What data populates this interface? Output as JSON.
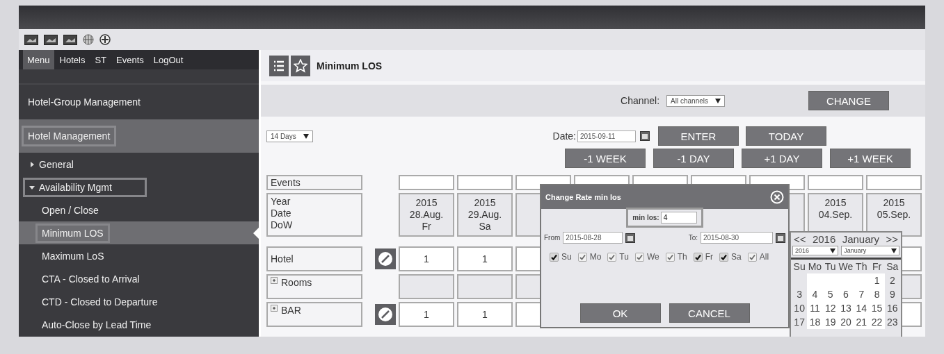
{
  "toolbar_icons": [
    {
      "kind": "image"
    },
    {
      "kind": "image"
    },
    {
      "kind": "image"
    },
    {
      "kind": "globe"
    },
    {
      "kind": "plus"
    }
  ],
  "nav": [
    {
      "label": "Menu",
      "selected": true
    },
    {
      "label": "Hotels",
      "selected": false
    },
    {
      "label": "ST",
      "selected": false
    },
    {
      "label": "Events",
      "selected": false
    },
    {
      "label": "LogOut",
      "selected": false
    }
  ],
  "sidebar": {
    "sections": [
      {
        "label": "Hotel-Group Management",
        "selected": false
      },
      {
        "label": "Hotel Management",
        "selected": true
      }
    ],
    "items": [
      {
        "label": "General",
        "expanded": false
      },
      {
        "label": "Availability Mgmt",
        "expanded": true,
        "children": [
          {
            "label": "Open / Close",
            "selected": false
          },
          {
            "label": "Minimum LOS",
            "selected": true
          },
          {
            "label": "Maximum LoS",
            "selected": false
          },
          {
            "label": "CTA - Closed to Arrival",
            "selected": false
          },
          {
            "label": "CTD - Closed to Departure",
            "selected": false
          },
          {
            "label": "Auto-Close by Lead Time",
            "selected": false
          }
        ]
      }
    ]
  },
  "page_title": "Minimum LOS",
  "channel": {
    "label": "Channel:",
    "value": "All channels",
    "button": "CHANGE"
  },
  "range_select": "14 Days",
  "date": {
    "label": "Date:",
    "value": "2015-09-11"
  },
  "buttons_row1": [
    "ENTER",
    "TODAY"
  ],
  "buttons_row2": [
    "-1 WEEK",
    "-1 DAY",
    "+1 DAY",
    "+1 WEEK"
  ],
  "grid": {
    "events_label": "Events",
    "header_labels": [
      "Year",
      "Date",
      "DoW"
    ],
    "columns": [
      {
        "year": "2015",
        "date": "28.Aug.",
        "dow": "Fr"
      },
      {
        "year": "2015",
        "date": "29.Aug.",
        "dow": "Sa"
      },
      {},
      {},
      {},
      {},
      {},
      {
        "year": "2015",
        "date": "04.Sep."
      },
      {
        "year": "2015",
        "date": "05.Sep."
      }
    ],
    "rows": [
      {
        "label": "Hotel",
        "kind": "value",
        "editable": true,
        "values": [
          "1",
          "1"
        ]
      },
      {
        "label": "Rooms",
        "kind": "group",
        "editable": false,
        "values": []
      },
      {
        "label": "BAR",
        "kind": "group-value",
        "editable": true,
        "values": [
          "1",
          "1"
        ]
      }
    ]
  },
  "dialog": {
    "title": "Change Rate min los",
    "min_los_label": "min los:",
    "min_los_value": "4",
    "from_label": "From",
    "from_value": "2015-08-28",
    "to_label": "To:",
    "to_value": "2015-08-30",
    "days": [
      {
        "label": "Su",
        "checked": true,
        "disabled": false
      },
      {
        "label": "Mo",
        "checked": true,
        "disabled": true
      },
      {
        "label": "Tu",
        "checked": true,
        "disabled": true
      },
      {
        "label": "We",
        "checked": true,
        "disabled": true
      },
      {
        "label": "Th",
        "checked": true,
        "disabled": true
      },
      {
        "label": "Fr",
        "checked": true,
        "disabled": false
      },
      {
        "label": "Sa",
        "checked": true,
        "disabled": false
      },
      {
        "label": "All",
        "checked": true,
        "disabled": true
      }
    ],
    "ok": "OK",
    "cancel": "CANCEL"
  },
  "calendar": {
    "prev": "<<",
    "year": "2016",
    "month": "January",
    "next": ">>",
    "year_select": "2016",
    "month_select": "January",
    "weekdays": [
      "Su",
      "Mo",
      "Tu",
      "We",
      "Th",
      "Fr",
      "Sa"
    ],
    "weeks": [
      [
        "1",
        "2"
      ],
      [
        "3",
        "4",
        "5",
        "6",
        "7",
        "8",
        "9"
      ],
      [
        "10",
        "11",
        "12",
        "13",
        "14",
        "15",
        "16"
      ],
      [
        "17",
        "18",
        "19",
        "20",
        "21",
        "22",
        "23"
      ]
    ]
  }
}
